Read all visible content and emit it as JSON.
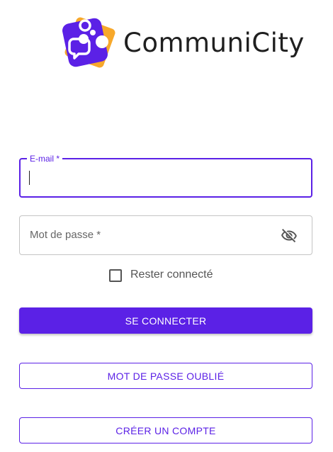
{
  "brand": {
    "name": "CommuniCity",
    "accent": "#5b21e6",
    "logo_secondary": "#f7a82b"
  },
  "form": {
    "email": {
      "label": "E-mail *",
      "value": ""
    },
    "password": {
      "label": "Mot de passe *",
      "value": "",
      "toggle_icon": "eye-off-icon"
    },
    "remember": {
      "label": "Rester connecté",
      "checked": false
    },
    "submit_label": "SE CONNECTER",
    "forgot_label": "MOT DE PASSE OUBLIÉ",
    "create_label": "CRÉER UN COMPTE"
  }
}
